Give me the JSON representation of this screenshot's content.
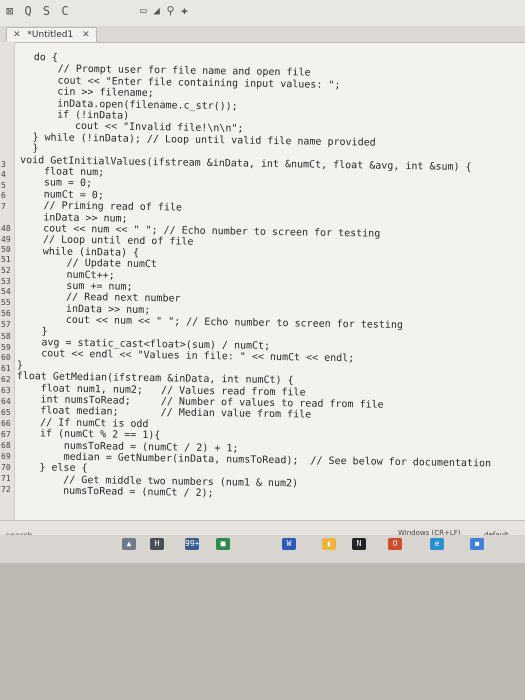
{
  "toolbar": {
    "left_icons": "⊠ Q S C",
    "right_icons": "▭ ◢ ⚲ ✚"
  },
  "tabs": [
    {
      "label": "*Untitled1"
    }
  ],
  "gutter": {
    "lines": [
      "3",
      "4",
      "5",
      "6",
      "7",
      "48",
      "49",
      "50",
      "51",
      "52",
      "53",
      "54",
      "55",
      "56",
      "57",
      "58",
      "59",
      "60",
      "61",
      "62",
      "63",
      "64",
      "65",
      "66",
      "67",
      "68",
      "69",
      "70",
      "71",
      "72"
    ]
  },
  "code_lines": [
    "  do {",
    "      // Prompt user for file name and open file",
    "      cout << \"Enter file containing input values: \";",
    "      cin >> filename;",
    "      inData.open(filename.c_str());",
    "      if (!inData)",
    "         cout << \"Invalid file!\\n\\n\";",
    "  } while (!inData); // Loop until valid file name provided",
    "  }",
    "void GetInitialValues(ifstream &inData, int &numCt, float &avg, int &sum) {",
    "    float num;",
    "    sum = 0;",
    "    numCt = 0;",
    "    // Priming read of file",
    "    inData >> num;",
    "    cout << num << \" \"; // Echo number to screen for testing",
    "    // Loop until end of file",
    "    while (inData) {",
    "        // Update numCt",
    "        numCt++;",
    "        sum += num;",
    "        // Read next number",
    "        inData >> num;",
    "        cout << num << \" \"; // Echo number to screen for testing",
    "    }",
    "    avg = static_cast<float>(sum) / numCt;",
    "    cout << endl << \"Values in file: \" << numCt << endl;",
    "}",
    "float GetMedian(ifstream &inData, int numCt) {",
    "    float num1, num2;   // Values read from file",
    "    int numsToRead;     // Number of values to read from file",
    "    float median;       // Median value from file",
    "    // If numCt is odd",
    "    if (numCt % 2 == 1){",
    "        numsToRead = (numCt / 2) + 1;",
    "        median = GetNumber(inData, numsToRead);  // See below for documentation",
    "    } else {",
    "        // Get middle two numbers (num1 & num2)",
    "        numsToRead = (numCt / 2);"
  ],
  "status": {
    "search": "search",
    "encoding": "Windows (CR+LF)",
    "syntax": "default"
  },
  "taskbar": {
    "items": [
      {
        "name": "taskbar-item-1",
        "glyph": "▲",
        "color": "#6d7b8a"
      },
      {
        "name": "taskbar-item-2",
        "glyph": "H",
        "color": "#4a4f57"
      },
      {
        "name": "taskbar-item-3",
        "glyph": "99+",
        "color": "#3b5d89"
      },
      {
        "name": "taskbar-item-4",
        "glyph": "■",
        "color": "#2f8a4b"
      },
      {
        "name": "taskbar-item-5",
        "glyph": "W",
        "color": "#2c5bb5"
      },
      {
        "name": "taskbar-item-6",
        "glyph": "▮",
        "color": "#f0b43c"
      },
      {
        "name": "taskbar-item-7",
        "glyph": "N",
        "color": "#222"
      },
      {
        "name": "taskbar-item-8",
        "glyph": "O",
        "color": "#d24a2e"
      },
      {
        "name": "taskbar-item-9",
        "glyph": "e",
        "color": "#2b8ed0"
      },
      {
        "name": "taskbar-item-10",
        "glyph": "◼",
        "color": "#3f7fd8"
      }
    ]
  }
}
